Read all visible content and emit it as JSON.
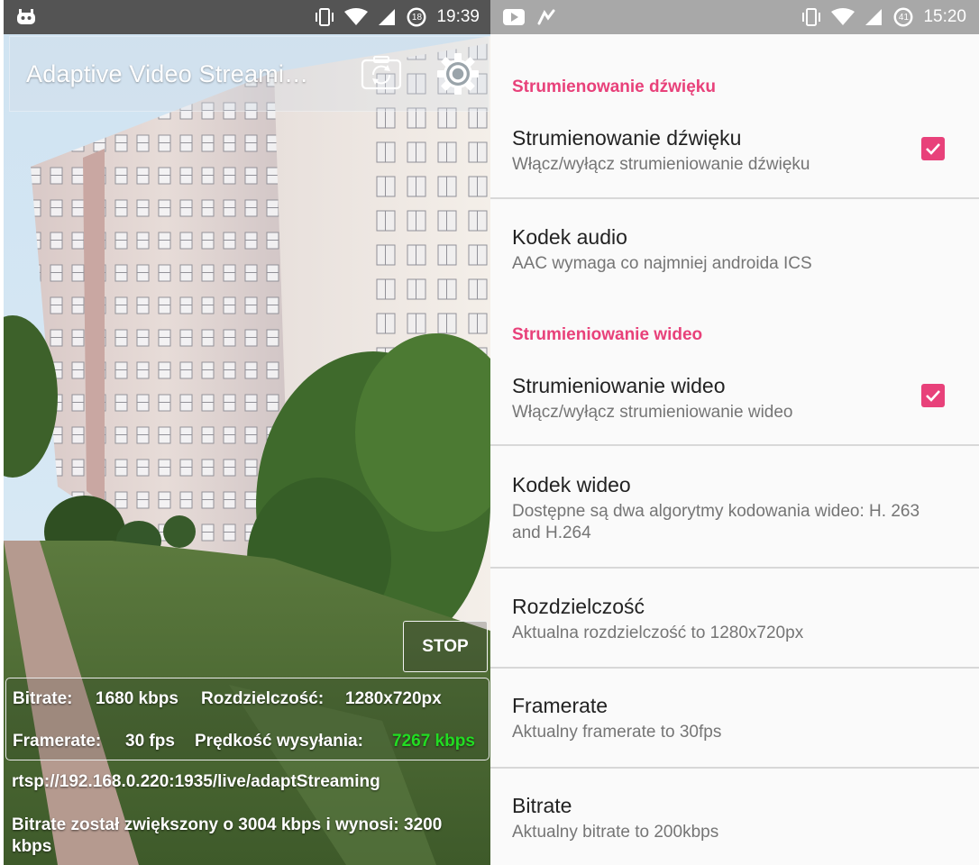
{
  "left_phone": {
    "status_bar": {
      "time": "19:39",
      "notification_badge": "18",
      "icons": [
        "android-debug-icon",
        "vibrate-icon",
        "wifi-icon",
        "signal-icon",
        "battery-icon"
      ]
    },
    "app_bar": {
      "title": "Adaptive Video Streami…",
      "icons": [
        "switch-camera-icon",
        "gear-icon"
      ]
    },
    "stop_label": "STOP",
    "stats": {
      "bitrate_label": "Bitrate:",
      "bitrate_value": "1680 kbps",
      "resolution_label": "Rozdzielczość:",
      "resolution_value": "1280x720px",
      "framerate_label": "Framerate:",
      "framerate_value": "30 fps",
      "upload_label": "Prędkość wysyłania:",
      "upload_value": "7267 kbps"
    },
    "stream_url": "rtsp://192.168.0.220:1935/live/adaptStreaming",
    "message": "Bitrate został zwiększony o 3004 kbps i wynosi: 3200 kbps",
    "colors": {
      "upload_value": "#22dd22"
    }
  },
  "right_phone": {
    "status_bar": {
      "time": "15:20",
      "notification_badge": "41",
      "icons": [
        "youtube-icon",
        "gesture-icon",
        "vibrate-icon",
        "wifi-icon",
        "signal-icon"
      ]
    },
    "categories": {
      "audio": "Strumienowanie dźwięku",
      "video": "Strumieniowanie wideo"
    },
    "preferences": [
      {
        "title": "Strumienowanie dźwięku",
        "summary": "Włącz/wyłącz strumieniowanie dźwięku",
        "checked": true
      },
      {
        "title": "Kodek audio",
        "summary": "AAC wymaga co najmniej androida ICS"
      },
      {
        "title": "Strumieniowanie wideo",
        "summary": "Włącz/wyłącz strumieniowanie wideo",
        "checked": true
      },
      {
        "title": "Kodek wideo",
        "summary": "Dostępne są dwa algorytmy kodowania wideo: H. 263 and H.264"
      },
      {
        "title": "Rozdzielczość",
        "summary": "Aktualna rozdzielczość to 1280x720px"
      },
      {
        "title": "Framerate",
        "summary": "Aktualny framerate to 30fps"
      },
      {
        "title": "Bitrate",
        "summary": "Aktualny bitrate to 200kbps"
      }
    ],
    "colors": {
      "accent": "#e8417a"
    }
  }
}
